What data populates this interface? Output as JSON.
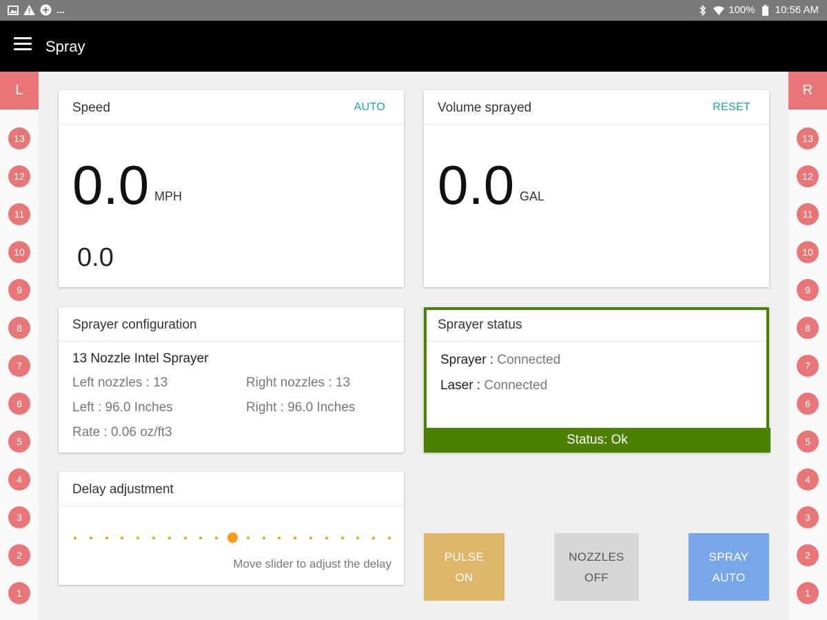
{
  "status_bar": {
    "overflow": "...",
    "battery": "100%",
    "time": "10:56 AM",
    "icons": [
      "image-icon",
      "warning-icon",
      "plus-circle-icon",
      "bluetooth-icon",
      "wifi-icon",
      "battery-icon"
    ]
  },
  "app_bar": {
    "title": "Spray",
    "menu_icon": "hamburger-menu-icon"
  },
  "left_rail": {
    "label": "L",
    "nozzles": [
      "13",
      "12",
      "11",
      "10",
      "9",
      "8",
      "7",
      "6",
      "5",
      "4",
      "3",
      "2",
      "1"
    ]
  },
  "right_rail": {
    "label": "R",
    "nozzles": [
      "13",
      "12",
      "11",
      "10",
      "9",
      "8",
      "7",
      "6",
      "5",
      "4",
      "3",
      "2",
      "1"
    ]
  },
  "speed": {
    "title": "Speed",
    "action": "AUTO",
    "value": "0.0",
    "unit": "MPH",
    "secondary": "0.0"
  },
  "volume": {
    "title": "Volume sprayed",
    "action": "RESET",
    "value": "0.0",
    "unit": "GAL"
  },
  "config": {
    "title": "Sprayer configuration",
    "name": "13 Nozzle Intel Sprayer",
    "left_nozzles": "Left nozzles : 13",
    "right_nozzles": "Right nozzles : 13",
    "left_width": "Left : 96.0 Inches",
    "right_width": "Right : 96.0 Inches",
    "rate": "Rate : 0.06 oz/ft3"
  },
  "status": {
    "title": "Sprayer status",
    "sprayer_key": "Sprayer :",
    "sprayer_value": "Connected",
    "laser_key": "Laser :",
    "laser_value": "Connected",
    "bar": "Status: Ok"
  },
  "delay": {
    "title": "Delay adjustment",
    "hint": "Move slider to adjust the delay",
    "steps": 21,
    "selected_step": 10
  },
  "buttons": {
    "pulse": {
      "line1": "PULSE",
      "line2": "ON"
    },
    "nozzles": {
      "line1": "NOZZLES",
      "line2": "OFF"
    },
    "spray": {
      "line1": "SPRAY",
      "line2": "AUTO"
    }
  },
  "colors": {
    "nozzle": "#e87676",
    "accent_teal": "#1ba39c",
    "status_green": "#4a8100",
    "slider_orange": "#f39c12",
    "pulse_button": "#dfb56b",
    "nozzles_button": "#d6d6d6",
    "spray_button": "#77a6ec"
  }
}
